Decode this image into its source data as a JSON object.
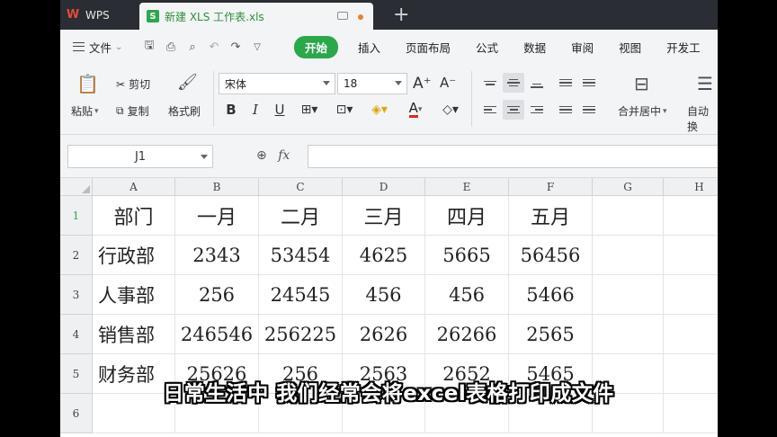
{
  "titlebar": {
    "app_tab": "WPS",
    "doc_tab": "新建 XLS 工作表.xls",
    "new_tab": "+"
  },
  "menubar": {
    "file": "文件",
    "items": [
      "开始",
      "插入",
      "页面布局",
      "公式",
      "数据",
      "审阅",
      "视图",
      "开发工"
    ]
  },
  "ribbon": {
    "paste": "粘贴",
    "cut": "剪切",
    "copy": "复制",
    "format_painter": "格式刷",
    "font_name": "宋体",
    "font_size": "18",
    "bold": "B",
    "italic": "I",
    "underline": "U",
    "font_color_letter": "A",
    "merge_center": "合并居中",
    "auto_wrap": "自动换"
  },
  "formula_bar": {
    "name_box": "J1",
    "fx": "fx",
    "formula": ""
  },
  "grid": {
    "columns": [
      "A",
      "B",
      "C",
      "D",
      "E",
      "F",
      "G",
      "H"
    ],
    "rows": [
      "1",
      "2",
      "3",
      "4",
      "5",
      "6"
    ],
    "data": [
      [
        "部门",
        "一月",
        "二月",
        "三月",
        "四月",
        "五月"
      ],
      [
        "行政部",
        "2343",
        "53454",
        "4625",
        "5665",
        "56456"
      ],
      [
        "人事部",
        "256",
        "24545",
        "456",
        "456",
        "5466"
      ],
      [
        "销售部",
        "246546",
        "256225",
        "2626",
        "26266",
        "2565"
      ],
      [
        "财务部",
        "25626",
        "256",
        "2563",
        "2652",
        "5465"
      ]
    ]
  },
  "subtitle": "日常生活中 我们经常会将excel表格打印成文件",
  "colors": {
    "accent": "#2aa84a",
    "titlebar": "#2a2d33",
    "ribbon_bg": "#f3f4f6"
  }
}
